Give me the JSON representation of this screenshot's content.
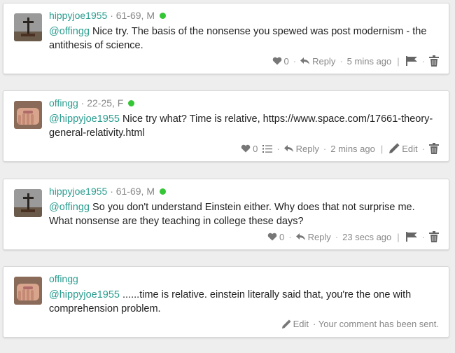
{
  "comments": [
    {
      "username": "hippyjoe1955",
      "meta": "· 61-69, M",
      "online": true,
      "mention": "@offingg",
      "text": " Nice try. The basis of the nonsense you spewed was post modernism - the antithesis of science.",
      "likes": "0",
      "reply_label": "Reply",
      "time": "5 mins ago"
    },
    {
      "username": "offingg",
      "meta": "· 22-25, F",
      "online": true,
      "mention": "@hippyjoe1955",
      "text": " Nice try what? Time is relative, https://www.space.com/17661-theory-general-relativity.html",
      "likes": "0",
      "reply_label": "Reply",
      "time": "2 mins ago",
      "edit_label": "Edit"
    },
    {
      "username": "hippyjoe1955",
      "meta": "· 61-69, M",
      "online": true,
      "mention": "@offingg",
      "text": " So you don't understand Einstein either. Why does that not surprise me. What nonsense are they teaching in college these days?",
      "likes": "0",
      "reply_label": "Reply",
      "time": "23 secs ago"
    },
    {
      "username": "offingg",
      "mention": "@hippyjoe1955",
      "text": " ......time is relative. einstein literally said that, you're the one with comprehension problem.",
      "edit_label": "Edit",
      "status": "· Your comment has been sent."
    }
  ],
  "icons": [
    "heart-icon",
    "reply-icon",
    "flag-icon",
    "trash-icon",
    "list-icon",
    "pencil-icon"
  ],
  "colors": {
    "username": "#2a9d8f",
    "online": "#35c635",
    "text": "#222222",
    "muted": "#888888"
  }
}
